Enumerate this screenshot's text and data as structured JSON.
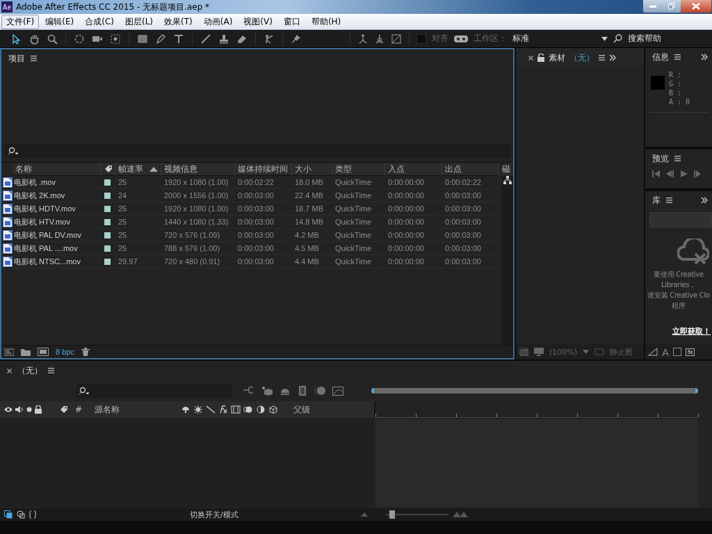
{
  "window": {
    "logo": "Ae",
    "title": "Adobe After Effects CC 2015 - 无标题项目.aep *"
  },
  "menu": [
    {
      "label": "文件(F)",
      "selected": true
    },
    {
      "label": "编辑(E)",
      "selected": false
    },
    {
      "label": "合成(C)",
      "selected": false
    },
    {
      "label": "图层(L)",
      "selected": false
    },
    {
      "label": "效果(T)",
      "selected": false
    },
    {
      "label": "动画(A)",
      "selected": false
    },
    {
      "label": "视图(V)",
      "selected": false
    },
    {
      "label": "窗口",
      "selected": false
    },
    {
      "label": "帮助(H)",
      "selected": false
    }
  ],
  "toolbar": {
    "tools": [
      {
        "kind": "select",
        "selected": true
      },
      {
        "kind": "hand",
        "selected": false
      },
      {
        "kind": "zoom",
        "selected": false
      },
      {
        "kind": "rotate",
        "selected": false
      },
      {
        "kind": "camera",
        "selected": false
      },
      {
        "kind": "pan",
        "selected": false
      },
      {
        "kind": "rect",
        "selected": false
      },
      {
        "kind": "pen",
        "selected": false
      },
      {
        "kind": "text",
        "selected": false
      },
      {
        "kind": "brush",
        "selected": false
      },
      {
        "kind": "stamp",
        "selected": false
      },
      {
        "kind": "eraser",
        "selected": false
      },
      {
        "kind": "roto",
        "selected": false
      },
      {
        "kind": "pin",
        "selected": false
      }
    ],
    "snap": {
      "label": "对齐",
      "checked": false
    },
    "workspace_label": "工作区：",
    "workspace": "标准",
    "search": "搜索帮助"
  },
  "project": {
    "title": "项目",
    "columns": [
      {
        "label": "名称",
        "sorted": false
      },
      {
        "label": "帧速率",
        "sorted": true
      },
      {
        "label": "视频信息",
        "sorted": false
      },
      {
        "label": "媒体持续时间",
        "sorted": false
      },
      {
        "label": "大小",
        "sorted": false
      },
      {
        "label": "类型",
        "sorted": false
      },
      {
        "label": "入点",
        "sorted": false
      },
      {
        "label": "出点",
        "sorted": false
      },
      {
        "label": "磁",
        "sorted": false
      }
    ],
    "rows": [
      [
        "电影机 .mov",
        "25",
        "1920 x 1080 (1.00)",
        "0:00:02:22",
        "18.0 MB",
        "QuickTime",
        "0:00:00:00",
        "0:00:02:22"
      ],
      [
        "电影机 2K.mov",
        "24",
        "2000 x 1556 (1.00)",
        "0:00:03:00",
        "22.4 MB",
        "QuickTime",
        "0:00:00:00",
        "0:00:03:00"
      ],
      [
        "电影机 HDTV.mov",
        "25",
        "1920 x 1080 (1.00)",
        "0:00:03:00",
        "18.7 MB",
        "QuickTime",
        "0:00:00:00",
        "0:00:03:00"
      ],
      [
        "电影机 HTV.mov",
        "25",
        "1440 x 1080 (1.33)",
        "0:00:03:00",
        "14.8 MB",
        "QuickTime",
        "0:00:00:00",
        "0:00:03:00"
      ],
      [
        "电影机 PAL DV.mov",
        "25",
        "720 x 576 (1.09)",
        "0:00:03:00",
        "4.2 MB",
        "QuickTime",
        "0:00:00:00",
        "0:00:03:00"
      ],
      [
        "电影机 PAL ....mov",
        "25",
        "788 x 576 (1.00)",
        "0:00:03:00",
        "4.5 MB",
        "QuickTime",
        "0:00:00:00",
        "0:00:03:00"
      ],
      [
        "电影机 NTSC...mov",
        "29.97",
        "720 x 480 (0.91)",
        "0:00:03:00",
        "4.4 MB",
        "QuickTime",
        "0:00:00:00",
        "0:00:03:00"
      ]
    ],
    "bit_depth": "8 bpc"
  },
  "footage": {
    "title": "素材",
    "subtitle": "（无）",
    "zoom": "(100%)",
    "view": "静止图"
  },
  "info": {
    "title": "信息",
    "lines": [
      "R :",
      "G :",
      "B :",
      "A : 0"
    ]
  },
  "preview": {
    "title": "预览"
  },
  "library": {
    "title": "库",
    "message_lines": [
      "要使用 Creative",
      "Libraries，",
      "请安装 Creative Clo",
      "程序"
    ],
    "link": "立即获取！",
    "char_icon": "A",
    "stock_badge": "St"
  },
  "timeline": {
    "title": "（无）",
    "columns": [
      "#",
      "源名称",
      "父级"
    ],
    "toggle": "切换开关/模式",
    "zoom_slider": {
      "level": 0.1
    }
  }
}
